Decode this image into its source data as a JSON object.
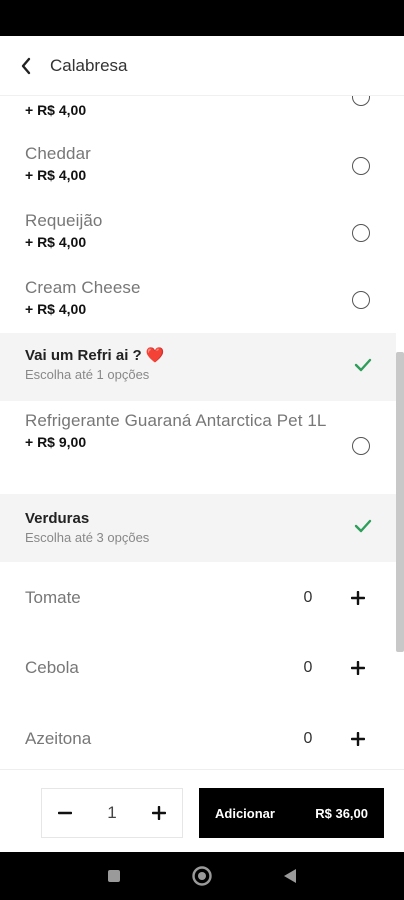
{
  "header": {
    "title": "Calabresa"
  },
  "options_top": [
    {
      "name": "",
      "price": "+ R$ 4,00"
    },
    {
      "name": "Cheddar",
      "price": "+ R$ 4,00"
    },
    {
      "name": "Requeijão",
      "price": "+ R$ 4,00"
    },
    {
      "name": "Cream Cheese",
      "price": "+ R$ 4,00"
    }
  ],
  "groups": [
    {
      "title": "Vai um Refri ai ? ❤️",
      "subtitle": "Escolha até 1 opções"
    },
    {
      "title": "Verduras",
      "subtitle": "Escolha até 3 opções"
    }
  ],
  "refri_option": {
    "name": "Refrigerante Guaraná Antarctica Pet 1L",
    "price": "+ R$ 9,00"
  },
  "vegetables": [
    {
      "name": "Tomate",
      "qty": "0"
    },
    {
      "name": "Cebola",
      "qty": "0"
    },
    {
      "name": "Azeitona",
      "qty": "0"
    }
  ],
  "footer": {
    "quantity": "1",
    "add_label": "Adicionar",
    "total": "R$ 36,00"
  },
  "colors": {
    "accent_check": "#2e9e5b",
    "primary_button": "#000000"
  }
}
